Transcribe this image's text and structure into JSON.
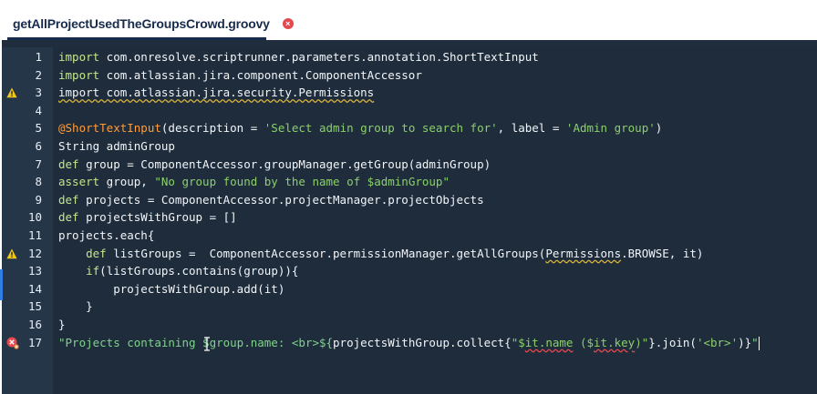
{
  "tab": {
    "title": "getAllProjectUsedTheGroupsCrowd.groovy"
  },
  "lines": [
    {
      "n": "1",
      "parts": [
        {
          "t": "import",
          "c": "kw"
        },
        {
          "t": " com.onresolve.scriptrunner.parameters.annotation.ShortTextInput",
          "c": ""
        }
      ]
    },
    {
      "n": "2",
      "parts": [
        {
          "t": "import",
          "c": "kw"
        },
        {
          "t": " com.atlassian.jira.component.ComponentAccessor",
          "c": ""
        }
      ]
    },
    {
      "n": "3",
      "parts": [
        {
          "t": "import com.atlassian.jira.security.Permissions",
          "c": "sqw"
        }
      ],
      "icon": "warning"
    },
    {
      "n": "4",
      "parts": []
    },
    {
      "n": "5",
      "parts": [
        {
          "t": "@ShortTextInput",
          "c": "ann"
        },
        {
          "t": "(description = ",
          "c": ""
        },
        {
          "t": "'Select admin group to search for'",
          "c": "str"
        },
        {
          "t": ", label = ",
          "c": ""
        },
        {
          "t": "'Admin group'",
          "c": "str"
        },
        {
          "t": ")",
          "c": ""
        }
      ]
    },
    {
      "n": "6",
      "parts": [
        {
          "t": "String adminGroup",
          "c": ""
        }
      ]
    },
    {
      "n": "7",
      "parts": [
        {
          "t": "def",
          "c": "kw"
        },
        {
          "t": " group = ComponentAccessor.groupManager.getGroup(adminGroup)",
          "c": ""
        }
      ]
    },
    {
      "n": "8",
      "parts": [
        {
          "t": "assert",
          "c": "kw"
        },
        {
          "t": " group, ",
          "c": ""
        },
        {
          "t": "\"No group found by the name of $adminGroup\"",
          "c": "str"
        }
      ]
    },
    {
      "n": "9",
      "parts": [
        {
          "t": "def",
          "c": "kw"
        },
        {
          "t": " projects = ComponentAccessor.projectManager.projectObjects",
          "c": ""
        }
      ]
    },
    {
      "n": "10",
      "parts": [
        {
          "t": "def",
          "c": "kw"
        },
        {
          "t": " projectsWithGroup = []",
          "c": ""
        }
      ]
    },
    {
      "n": "11",
      "parts": [
        {
          "t": "projects.each{",
          "c": ""
        }
      ]
    },
    {
      "n": "12",
      "parts": [
        {
          "t": "    ",
          "c": ""
        },
        {
          "t": "def",
          "c": "kw"
        },
        {
          "t": " listGroups =  ComponentAccessor.permissionManager.getAllGroups(",
          "c": ""
        },
        {
          "t": "Permissions",
          "c": "sqw"
        },
        {
          "t": ".BROWSE, it)",
          "c": ""
        }
      ],
      "icon": "warning"
    },
    {
      "n": "13",
      "parts": [
        {
          "t": "    ",
          "c": ""
        },
        {
          "t": "if",
          "c": "kw"
        },
        {
          "t": "(listGroups.contains(group)){",
          "c": ""
        }
      ]
    },
    {
      "n": "14",
      "parts": [
        {
          "t": "        projectsWithGroup.add(it)",
          "c": ""
        }
      ]
    },
    {
      "n": "15",
      "parts": [
        {
          "t": "    }",
          "c": ""
        }
      ]
    },
    {
      "n": "16",
      "parts": [
        {
          "t": "}",
          "c": ""
        }
      ]
    },
    {
      "n": "17",
      "parts": [
        {
          "t": "\"Projects containing $group.name: <br>${",
          "c": "str2"
        },
        {
          "t": "projectsWithGroup.collect{",
          "c": ""
        },
        {
          "t": "\"$",
          "c": "str"
        },
        {
          "t": "it.name",
          "c": "sqrstr"
        },
        {
          "t": " ($",
          "c": "str"
        },
        {
          "t": "it.key",
          "c": "sqrstr"
        },
        {
          "t": ")\"",
          "c": "str"
        },
        {
          "t": "}.join(",
          "c": ""
        },
        {
          "t": "'<br>'",
          "c": "str"
        },
        {
          "t": ")}",
          "c": ""
        },
        {
          "t": "\"",
          "c": "str2"
        }
      ],
      "icon": "error",
      "cursor": true
    }
  ]
}
